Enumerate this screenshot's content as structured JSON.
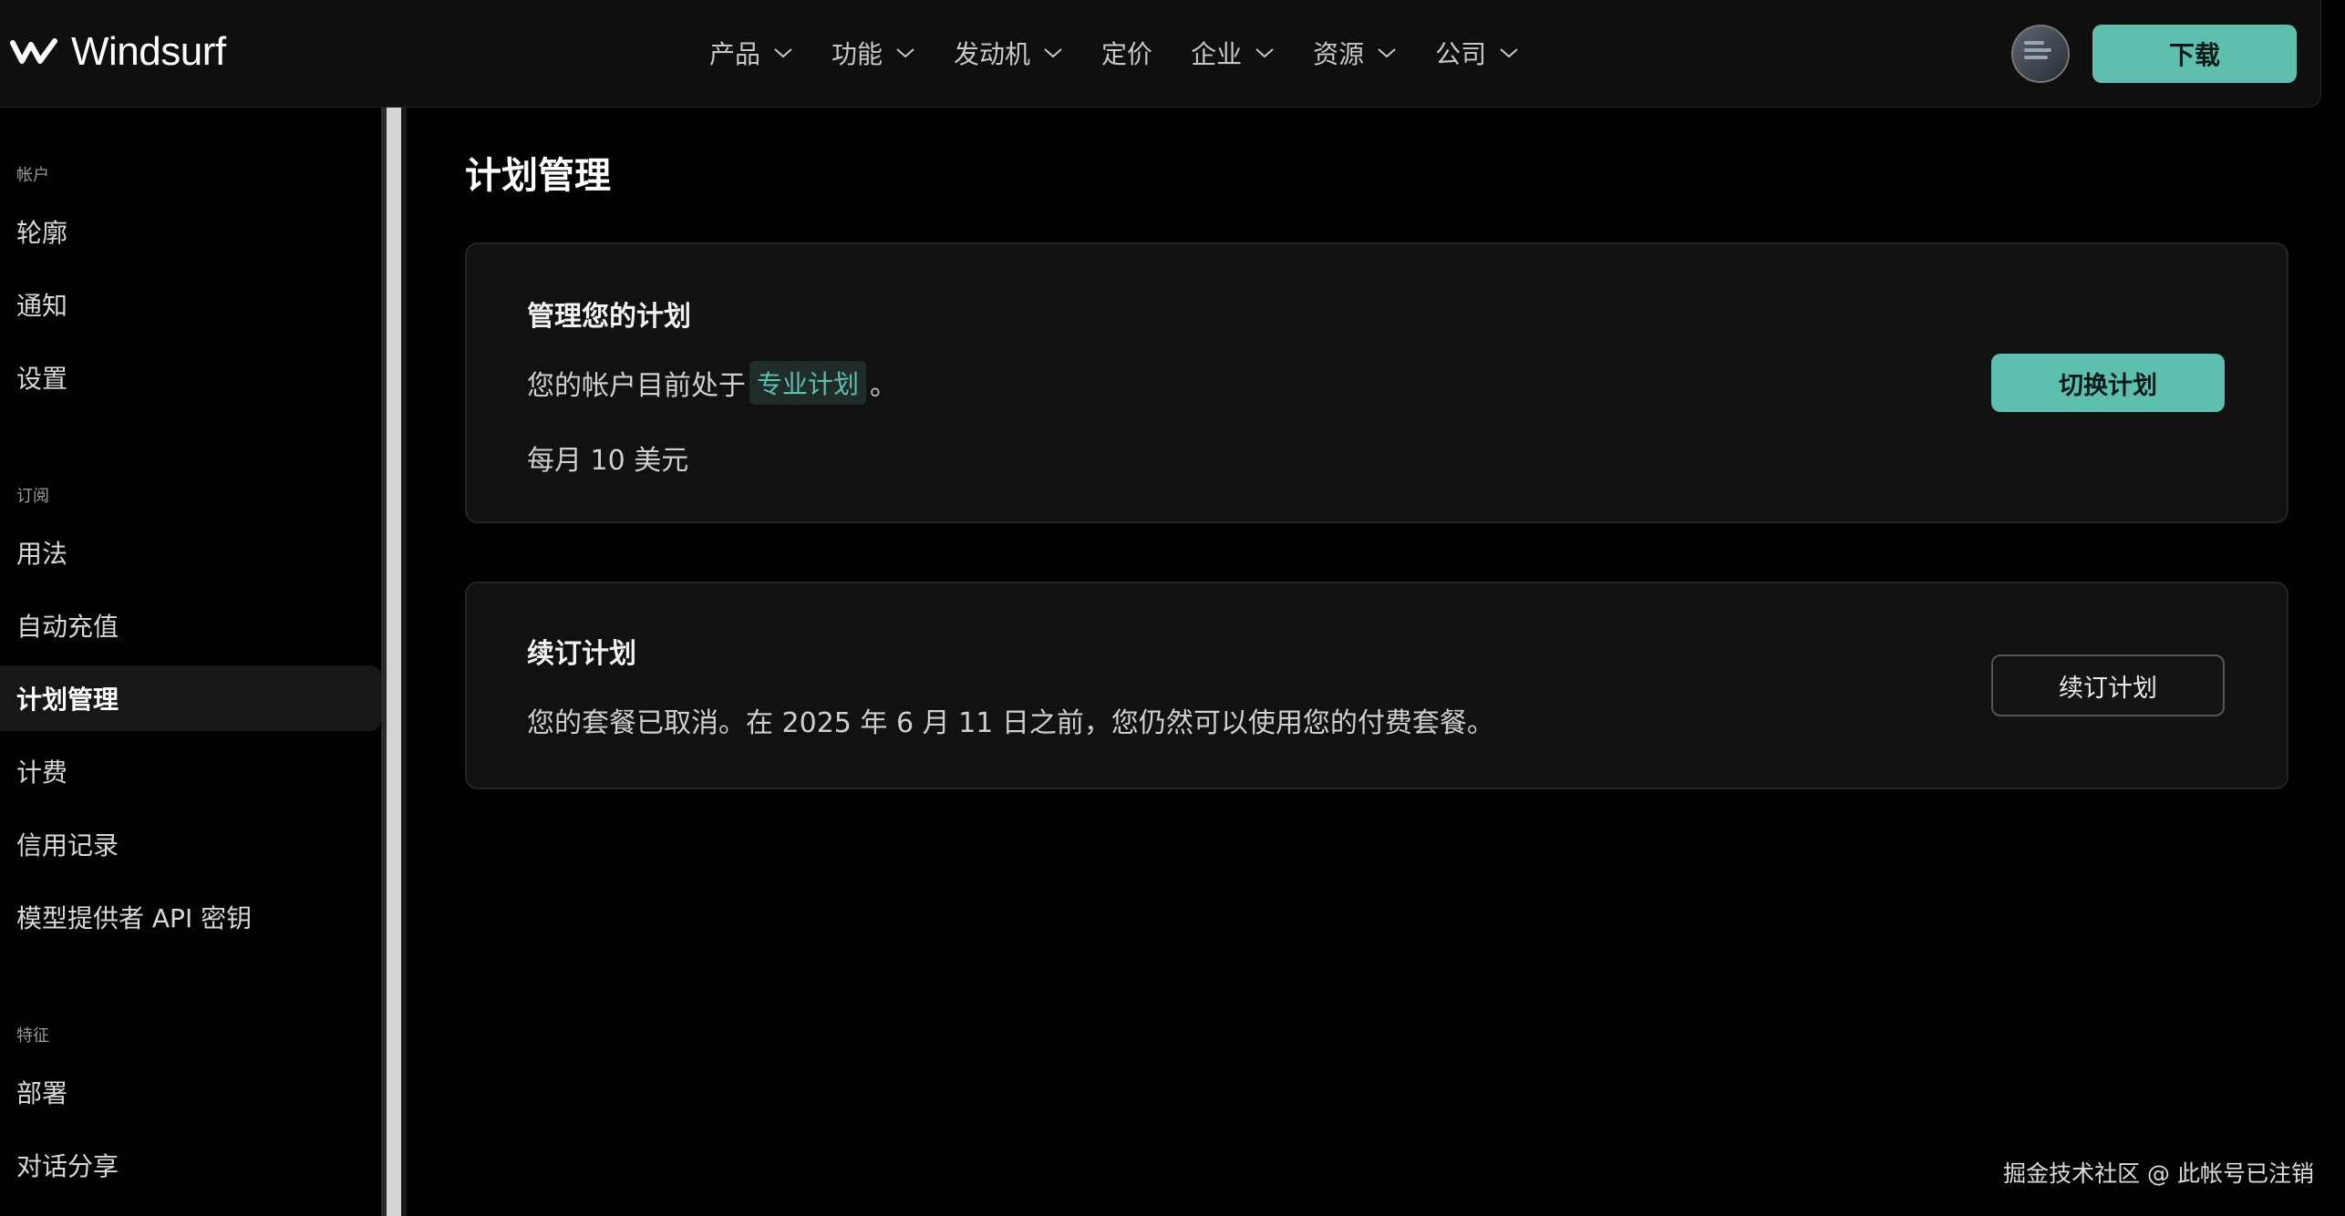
{
  "brand": {
    "name": "Windsurf",
    "logo_icon": "windsurf-wave-icon"
  },
  "nav": {
    "items": [
      {
        "label": "产品",
        "has_dropdown": true
      },
      {
        "label": "功能",
        "has_dropdown": true
      },
      {
        "label": "发动机",
        "has_dropdown": true
      },
      {
        "label": "定价",
        "has_dropdown": false
      },
      {
        "label": "企业",
        "has_dropdown": true
      },
      {
        "label": "资源",
        "has_dropdown": true
      },
      {
        "label": "公司",
        "has_dropdown": true
      }
    ],
    "download_label": "下载",
    "accent": "#5fbfae"
  },
  "sidebar": {
    "sections": [
      {
        "label": "帐户",
        "items": [
          "轮廓",
          "通知",
          "设置"
        ]
      },
      {
        "label": "订阅",
        "items": [
          "用法",
          "自动充值",
          "计划管理",
          "计费",
          "信用记录",
          "模型提供者 API 密钥"
        ]
      },
      {
        "label": "特征",
        "items": [
          "部署",
          "对话分享"
        ]
      }
    ],
    "active_item": "计划管理"
  },
  "main": {
    "title": "计划管理",
    "manage_card": {
      "title": "管理您的计划",
      "status_prefix": "您的帐户目前处于",
      "plan_name": "专业计划",
      "status_suffix": "。",
      "price": "每月 10 美元",
      "switch_button": "切换计划"
    },
    "renew_card": {
      "title": "续订计划",
      "message": "您的套餐已取消。在 2025 年 6 月 11 日之前，您仍然可以使用您的付费套餐。",
      "renew_button": "续订计划"
    }
  },
  "watermark": "掘金技术社区 @ 此帐号已注销"
}
